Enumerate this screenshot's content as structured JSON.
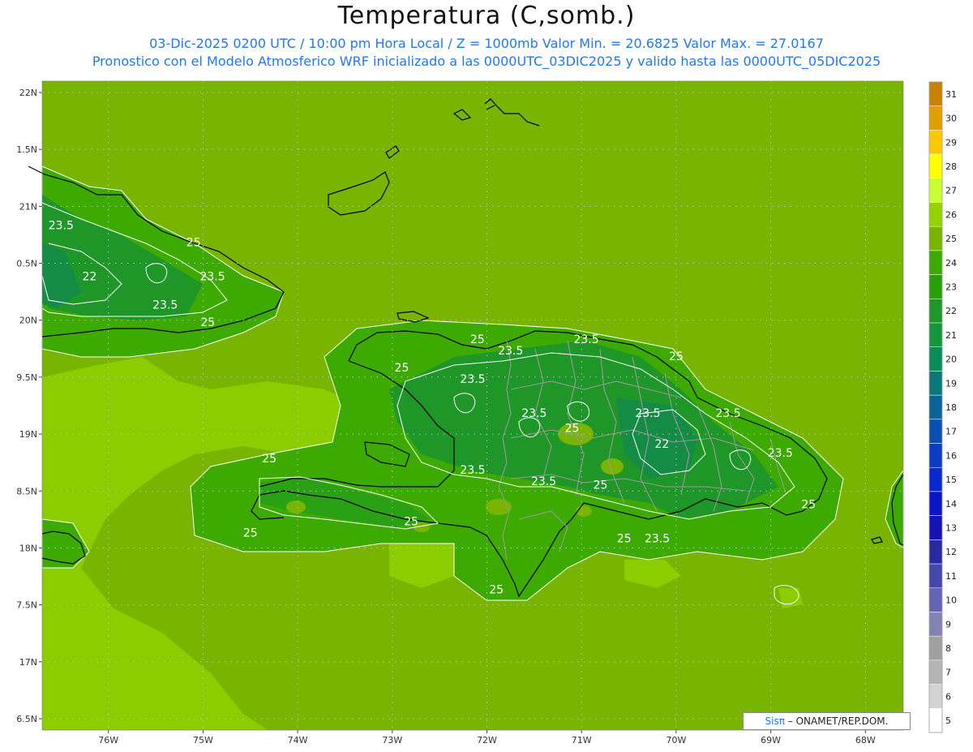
{
  "header": {
    "title": "Temperatura (C,somb.)",
    "subtitle1": "03-Dic-2025 0200 UTC / 10:00 pm Hora Local / Z = 1000mb   Valor Min. = 20.6825  Valor Max. = 27.0167",
    "subtitle2": "Pronostico con el Modelo Atmosferico WRF inicializado a las 0000UTC_03DIC2025 y valido hasta las  0000UTC_05DIC2025"
  },
  "map": {
    "lon_range": [
      -76.7,
      -67.6
    ],
    "lat_range": [
      16.4,
      22.1
    ],
    "lon_ticks": [
      "76W",
      "75W",
      "74W",
      "73W",
      "72W",
      "71W",
      "70W",
      "69W",
      "68W"
    ],
    "lon_values": [
      -76,
      -75,
      -74,
      -73,
      -72,
      -71,
      -70,
      -69,
      -68
    ],
    "lat_ticks": [
      "22N",
      "1.5N",
      "21N",
      "0.5N",
      "20N",
      "9.5N",
      "19N",
      "8.5N",
      "18N",
      "7.5N",
      "17N",
      "6.5N"
    ],
    "lat_values": [
      22,
      21.5,
      21,
      20.5,
      20,
      19.5,
      19,
      18.5,
      18,
      17.5,
      17,
      16.5
    ],
    "contour_labels": [
      {
        "text": "23.5",
        "lon": -76.5,
        "lat": 20.8
      },
      {
        "text": "25",
        "lon": -75.1,
        "lat": 20.65
      },
      {
        "text": "23.5",
        "lon": -74.9,
        "lat": 20.35
      },
      {
        "text": "22",
        "lon": -76.2,
        "lat": 20.35
      },
      {
        "text": "23.5",
        "lon": -75.4,
        "lat": 20.1
      },
      {
        "text": "25",
        "lon": -74.95,
        "lat": 19.95
      },
      {
        "text": "25",
        "lon": -72.9,
        "lat": 19.55
      },
      {
        "text": "25",
        "lon": -72.1,
        "lat": 19.8
      },
      {
        "text": "23.5",
        "lon": -71.75,
        "lat": 19.7
      },
      {
        "text": "23.5",
        "lon": -70.95,
        "lat": 19.8
      },
      {
        "text": "25",
        "lon": -70.0,
        "lat": 19.65
      },
      {
        "text": "23.5",
        "lon": -72.15,
        "lat": 19.45
      },
      {
        "text": "23.5",
        "lon": -71.5,
        "lat": 19.15
      },
      {
        "text": "23.5",
        "lon": -70.3,
        "lat": 19.15
      },
      {
        "text": "23.5",
        "lon": -69.45,
        "lat": 19.15
      },
      {
        "text": "25",
        "lon": -71.1,
        "lat": 19.02
      },
      {
        "text": "22",
        "lon": -70.15,
        "lat": 18.88
      },
      {
        "text": "23.5",
        "lon": -68.9,
        "lat": 18.8
      },
      {
        "text": "25",
        "lon": -74.3,
        "lat": 18.75
      },
      {
        "text": "23.5",
        "lon": -72.15,
        "lat": 18.65
      },
      {
        "text": "23.5",
        "lon": -71.4,
        "lat": 18.55
      },
      {
        "text": "25",
        "lon": -70.8,
        "lat": 18.52
      },
      {
        "text": "25",
        "lon": -68.6,
        "lat": 18.35
      },
      {
        "text": "25",
        "lon": -74.5,
        "lat": 18.1
      },
      {
        "text": "25",
        "lon": -72.8,
        "lat": 18.2
      },
      {
        "text": "25",
        "lon": -70.55,
        "lat": 18.05
      },
      {
        "text": "23.5",
        "lon": -70.2,
        "lat": 18.05
      },
      {
        "text": "25",
        "lon": -71.9,
        "lat": 17.6
      }
    ]
  },
  "colorbar": {
    "levels": [
      31,
      30,
      29,
      28,
      27,
      26,
      25,
      24,
      23,
      22,
      21,
      20,
      19,
      18,
      17,
      16,
      15,
      14,
      13,
      12,
      11,
      10,
      9,
      8,
      7,
      6,
      5
    ],
    "colors": [
      "#c88200",
      "#e0a000",
      "#ffc800",
      "#ffff00",
      "#c8ff32",
      "#96d200",
      "#78b400",
      "#3caa00",
      "#28a00a",
      "#1e9628",
      "#14963c",
      "#0a8c5a",
      "#0a7878",
      "#0a6496",
      "#0a50b4",
      "#0a3cc8",
      "#0a28d2",
      "#0a14c8",
      "#1414b4",
      "#2828a0",
      "#4646aa",
      "#6464b4",
      "#8282b4",
      "#a0a0a0",
      "#b4b4b4",
      "#d2d2d2",
      "#ffffff"
    ]
  },
  "credit": {
    "sis": "Sisπ",
    "text": " – ONAMET/REP.DOM."
  },
  "colors": {
    "sea_outer": "#78b400",
    "sea_mid": "#5aa400",
    "land": "#28a00a",
    "land_cool": "#1e9628",
    "shallow": "#8ccd00",
    "coast": "#000000",
    "border": "#999999",
    "contour": "#ffffff"
  }
}
